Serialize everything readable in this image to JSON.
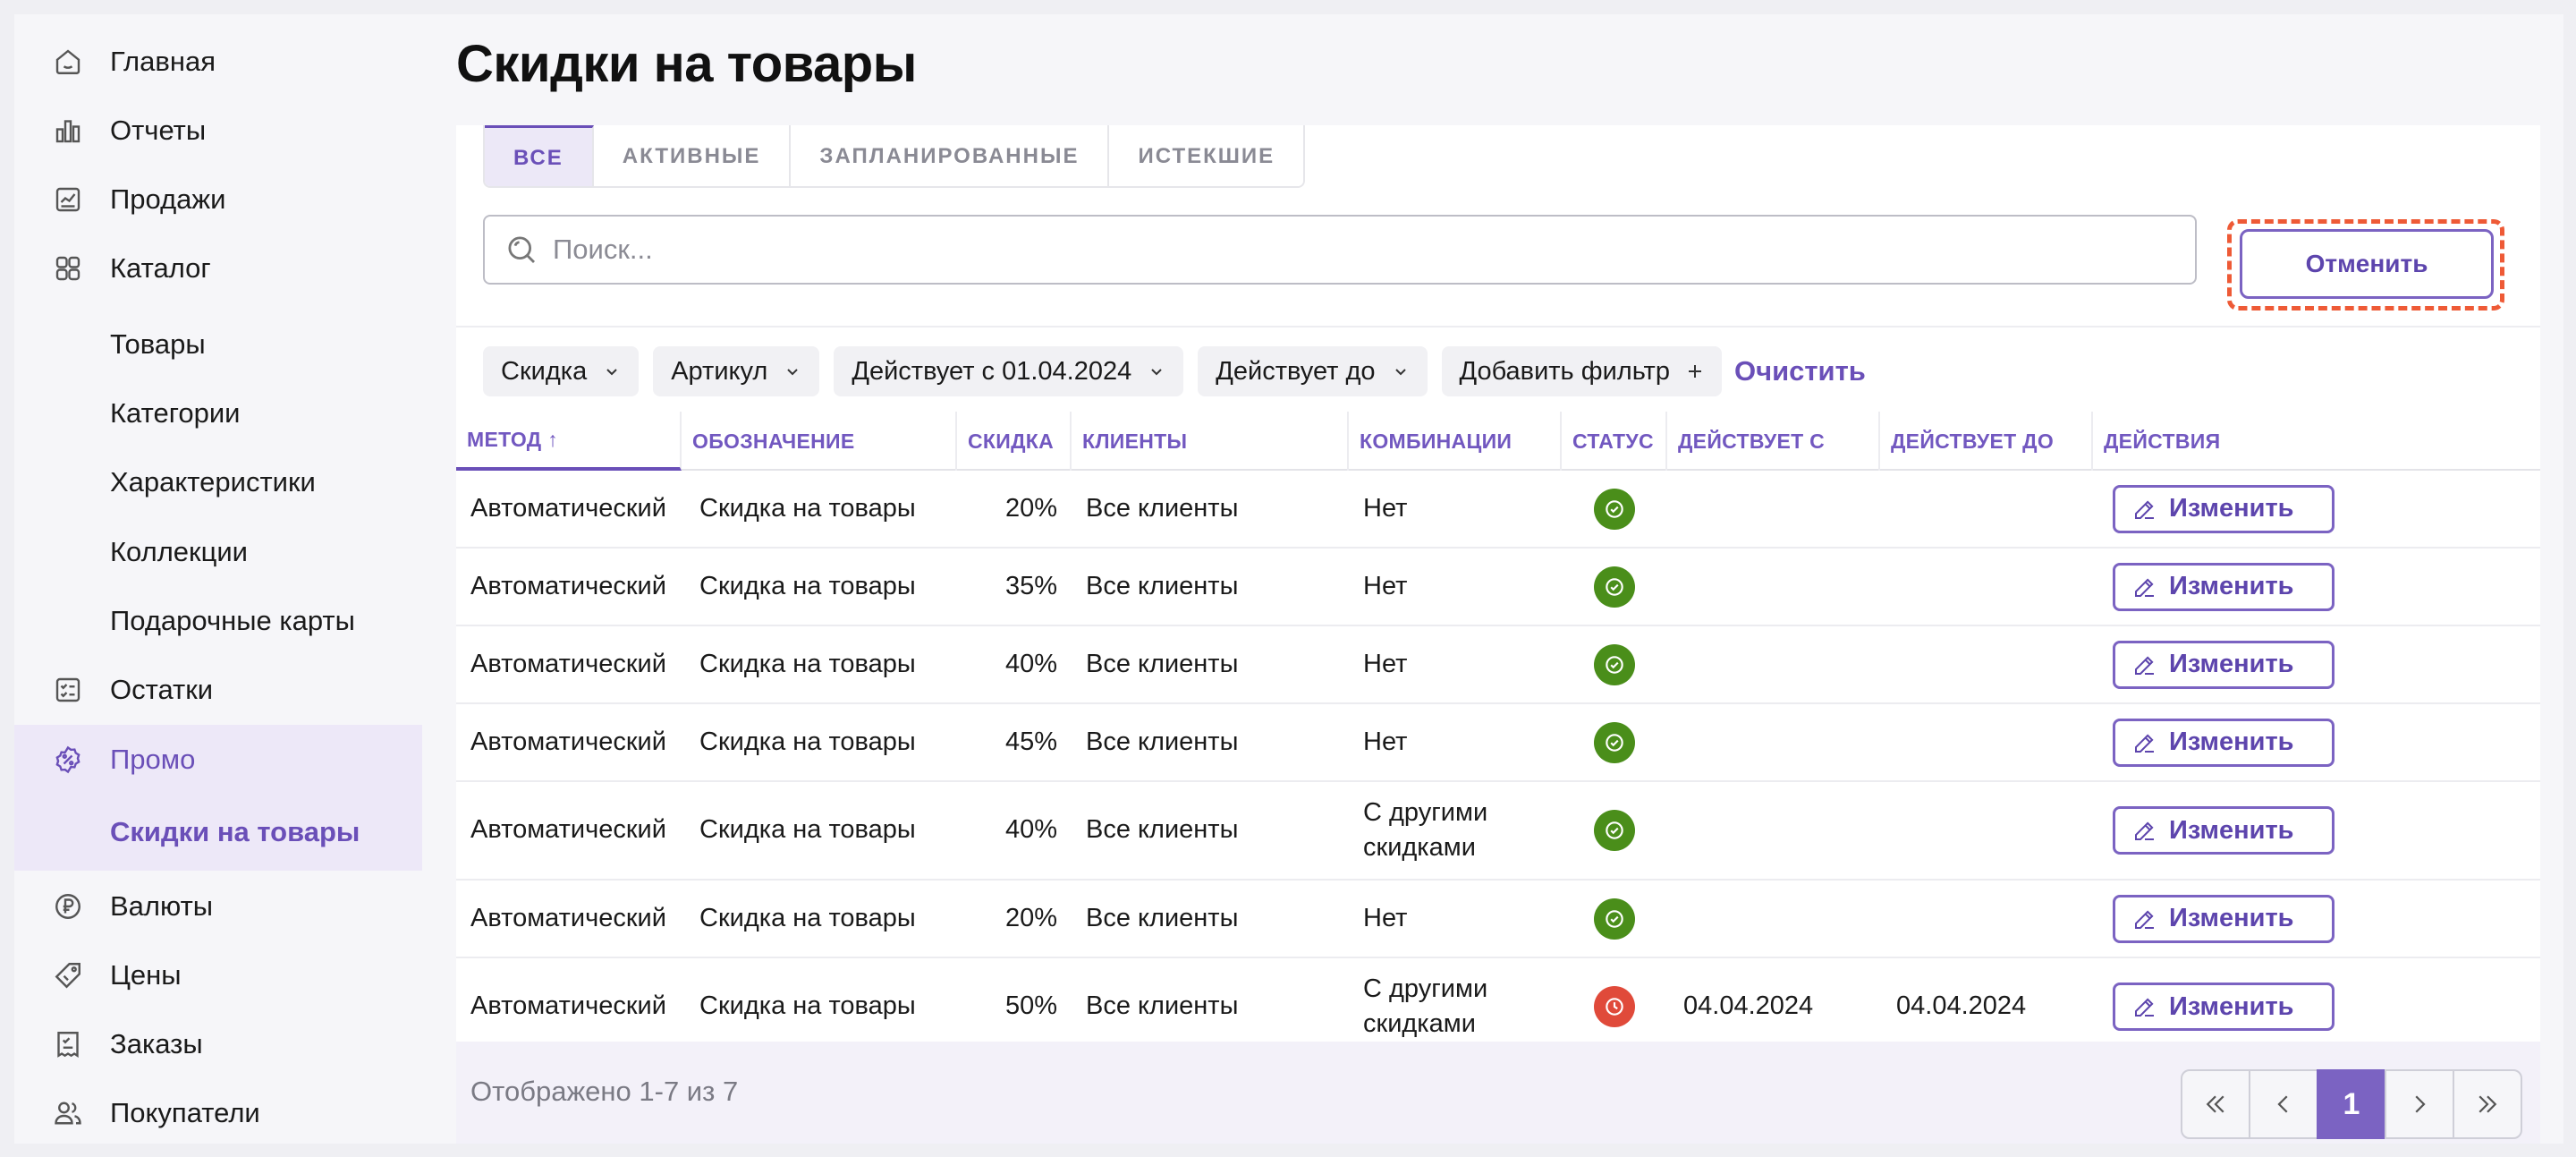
{
  "sidebar": {
    "items": [
      {
        "label": "Главная",
        "icon": "home-icon"
      },
      {
        "label": "Отчеты",
        "icon": "chart-icon"
      },
      {
        "label": "Продажи",
        "icon": "sales-icon"
      },
      {
        "label": "Каталог",
        "icon": "catalog-icon"
      },
      {
        "label": "Товары"
      },
      {
        "label": "Категории"
      },
      {
        "label": "Характеристики"
      },
      {
        "label": "Коллекции"
      },
      {
        "label": "Подарочные карты"
      },
      {
        "label": "Остатки",
        "icon": "stock-icon"
      },
      {
        "label": "Промо",
        "icon": "promo-icon"
      },
      {
        "label": "Скидки на товары"
      },
      {
        "label": "Валюты",
        "icon": "currency-icon"
      },
      {
        "label": "Цены",
        "icon": "price-tag-icon"
      },
      {
        "label": "Заказы",
        "icon": "orders-icon"
      },
      {
        "label": "Покупатели",
        "icon": "customers-icon"
      }
    ]
  },
  "page": {
    "title": "Скидки на товары"
  },
  "tabs": [
    {
      "label": "ВСЕ",
      "active": true
    },
    {
      "label": "АКТИВНЫЕ"
    },
    {
      "label": "ЗАПЛАНИРОВАННЫЕ"
    },
    {
      "label": "ИСТЕКШИЕ"
    }
  ],
  "search": {
    "placeholder": "Поиск...",
    "value": ""
  },
  "cancel_label": "Отменить",
  "filters": [
    {
      "label": "Скидка"
    },
    {
      "label": "Артикул"
    },
    {
      "label": "Действует с 01.04.2024"
    },
    {
      "label": "Действует до"
    }
  ],
  "add_filter_label": "Добавить фильтр",
  "clear_label": "Очистить",
  "table": {
    "columns": [
      "МЕТОД ↑",
      "ОБОЗНАЧЕНИЕ",
      "СКИДКА",
      "КЛИЕНТЫ",
      "КОМБИНАЦИИ",
      "СТАТУС",
      "ДЕЙСТВУЕТ С",
      "ДЕЙСТВУЕТ ДО",
      "ДЕЙСТВИЯ"
    ],
    "edit_label": "Изменить",
    "rows": [
      {
        "method": "Автоматический",
        "name": "Скидка на товары",
        "discount": "20%",
        "clients": "Все клиенты",
        "combo": "Нет",
        "status": "active",
        "from": "",
        "to": ""
      },
      {
        "method": "Автоматический",
        "name": "Скидка на товары",
        "discount": "35%",
        "clients": "Все клиенты",
        "combo": "Нет",
        "status": "active",
        "from": "",
        "to": ""
      },
      {
        "method": "Автоматический",
        "name": "Скидка на товары",
        "discount": "40%",
        "clients": "Все клиенты",
        "combo": "Нет",
        "status": "active",
        "from": "",
        "to": ""
      },
      {
        "method": "Автоматический",
        "name": "Скидка на товары",
        "discount": "45%",
        "clients": "Все клиенты",
        "combo": "Нет",
        "status": "active",
        "from": "",
        "to": ""
      },
      {
        "method": "Автоматический",
        "name": "Скидка на товары",
        "discount": "40%",
        "clients": "Все клиенты",
        "combo_line1": "С другими",
        "combo_line2": "скидками",
        "status": "active",
        "from": "",
        "to": ""
      },
      {
        "method": "Автоматический",
        "name": "Скидка на товары",
        "discount": "20%",
        "clients": "Все клиенты",
        "combo": "Нет",
        "status": "active",
        "from": "",
        "to": ""
      },
      {
        "method": "Автоматический",
        "name": "Скидка на товары",
        "discount": "50%",
        "clients": "Все клиенты",
        "combo_line1": "С другими",
        "combo_line2": "скидками",
        "status": "expired",
        "from": "04.04.2024",
        "to": "04.04.2024"
      }
    ]
  },
  "footer": {
    "summary": "Отображено 1-7 из 7",
    "current_page": "1"
  },
  "colors": {
    "accent": "#6a4fb8",
    "status_active": "#4a8e1a",
    "status_expired": "#e04a3a",
    "highlight": "#ee5a36"
  }
}
